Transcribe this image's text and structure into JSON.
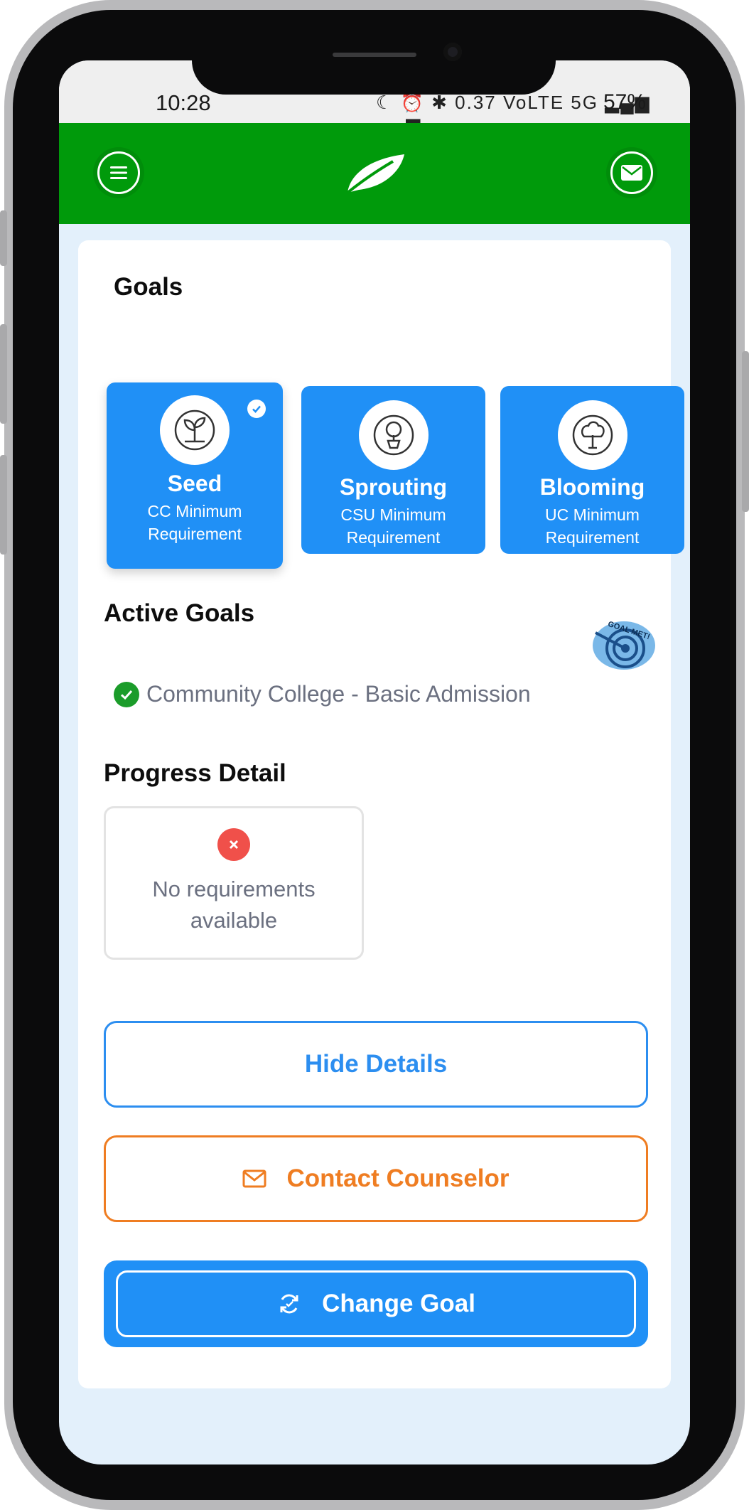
{
  "status_bar": {
    "time": "10:28",
    "icons_text": "☾ ⏰ ✱ 0.37 VoLTE 5G ▂▄▆ ▂▄▆",
    "battery": "57%"
  },
  "header": {
    "menu_icon": "hamburger-icon",
    "logo_icon": "leaf-logo",
    "mail_icon": "envelope-icon",
    "brand_color": "#009a0b"
  },
  "goals": {
    "title": "Goals",
    "items": [
      {
        "name": "Seed",
        "desc_line1": "CC Minimum",
        "desc_line2": "Requirement",
        "icon": "sprout-icon",
        "selected": true
      },
      {
        "name": "Sprouting",
        "desc_line1": "CSU Minimum",
        "desc_line2": "Requirement",
        "icon": "potted-tree-icon",
        "selected": false
      },
      {
        "name": "Blooming",
        "desc_line1": "UC Minimum",
        "desc_line2": "Requirement",
        "icon": "tree-icon",
        "selected": false
      }
    ]
  },
  "active_goals": {
    "title": "Active Goals",
    "badge_text": "GOAL MET!",
    "goal": "Community College - Basic Admission"
  },
  "progress": {
    "title": "Progress Detail",
    "line1": "No requirements",
    "line2": "available"
  },
  "buttons": {
    "hide_details": "Hide Details",
    "contact_counselor": "Contact Counselor",
    "change_goal": "Change Goal"
  },
  "colors": {
    "accent_blue": "#2090f6",
    "accent_orange": "#ef7d22",
    "success_green": "#1b9c2a",
    "error_red": "#f0504a"
  }
}
